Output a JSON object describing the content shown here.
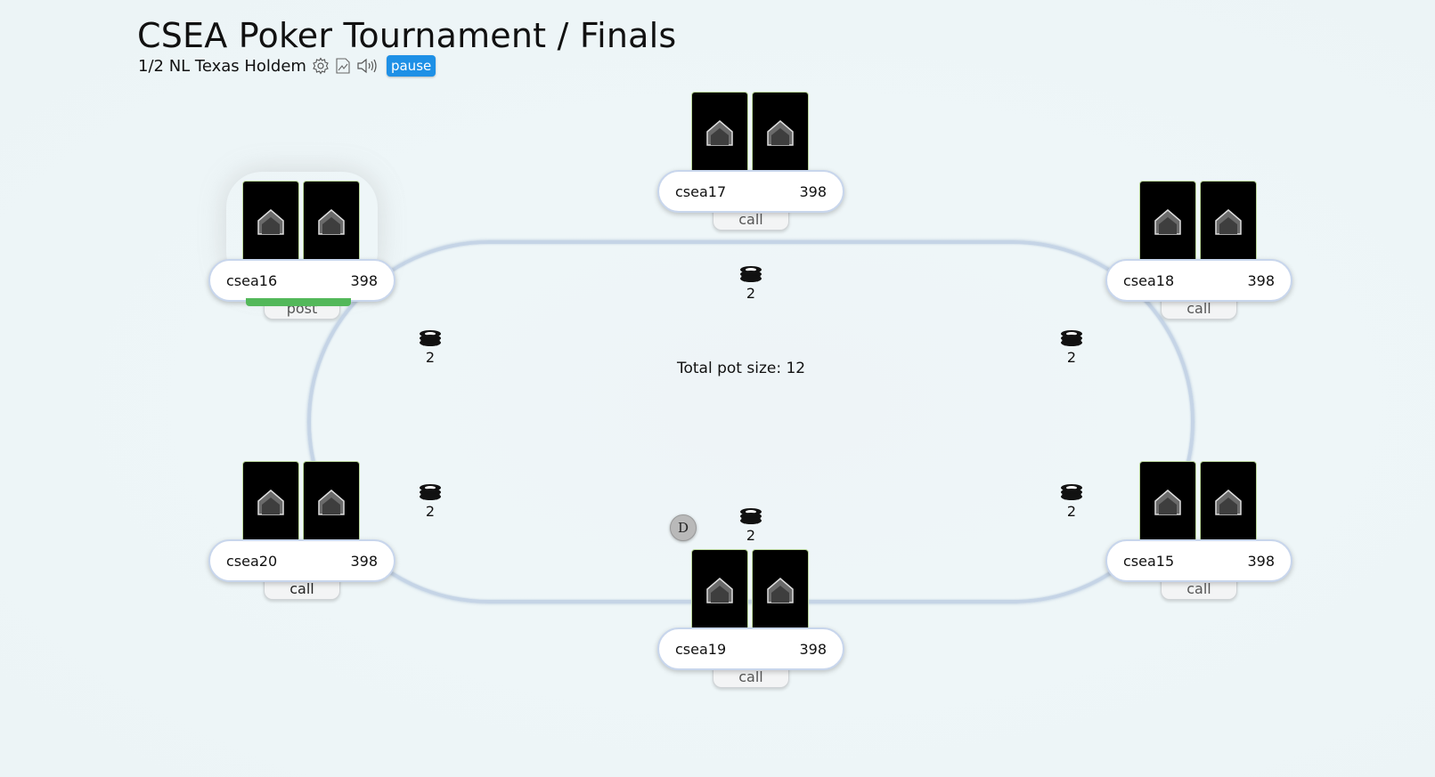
{
  "header": {
    "title": "CSEA Poker Tournament / Finals",
    "game_type": "1/2 NL Texas Holdem",
    "icons": [
      "gear-icon",
      "chart-icon",
      "speaker-icon"
    ],
    "pause_label": "pause",
    "accent_color": "#1e90e6"
  },
  "table": {
    "pot_label": "Total pot size: 12",
    "dealer_button": "D"
  },
  "seats": [
    {
      "name": "csea16",
      "stack": "398",
      "action": "post"
    },
    {
      "name": "csea17",
      "stack": "398",
      "action": "call"
    },
    {
      "name": "csea18",
      "stack": "398",
      "action": "call"
    },
    {
      "name": "csea20",
      "stack": "398",
      "action": "call"
    },
    {
      "name": "csea19",
      "stack": "398",
      "action": "call"
    },
    {
      "name": "csea15",
      "stack": "398",
      "action": "call"
    }
  ],
  "bets": [
    {
      "seat": "csea17",
      "amount": "2"
    },
    {
      "seat": "csea16",
      "amount": "2"
    },
    {
      "seat": "csea18",
      "amount": "2"
    },
    {
      "seat": "csea20",
      "amount": "2"
    },
    {
      "seat": "csea19",
      "amount": "2"
    },
    {
      "seat": "csea15",
      "amount": "2"
    }
  ]
}
